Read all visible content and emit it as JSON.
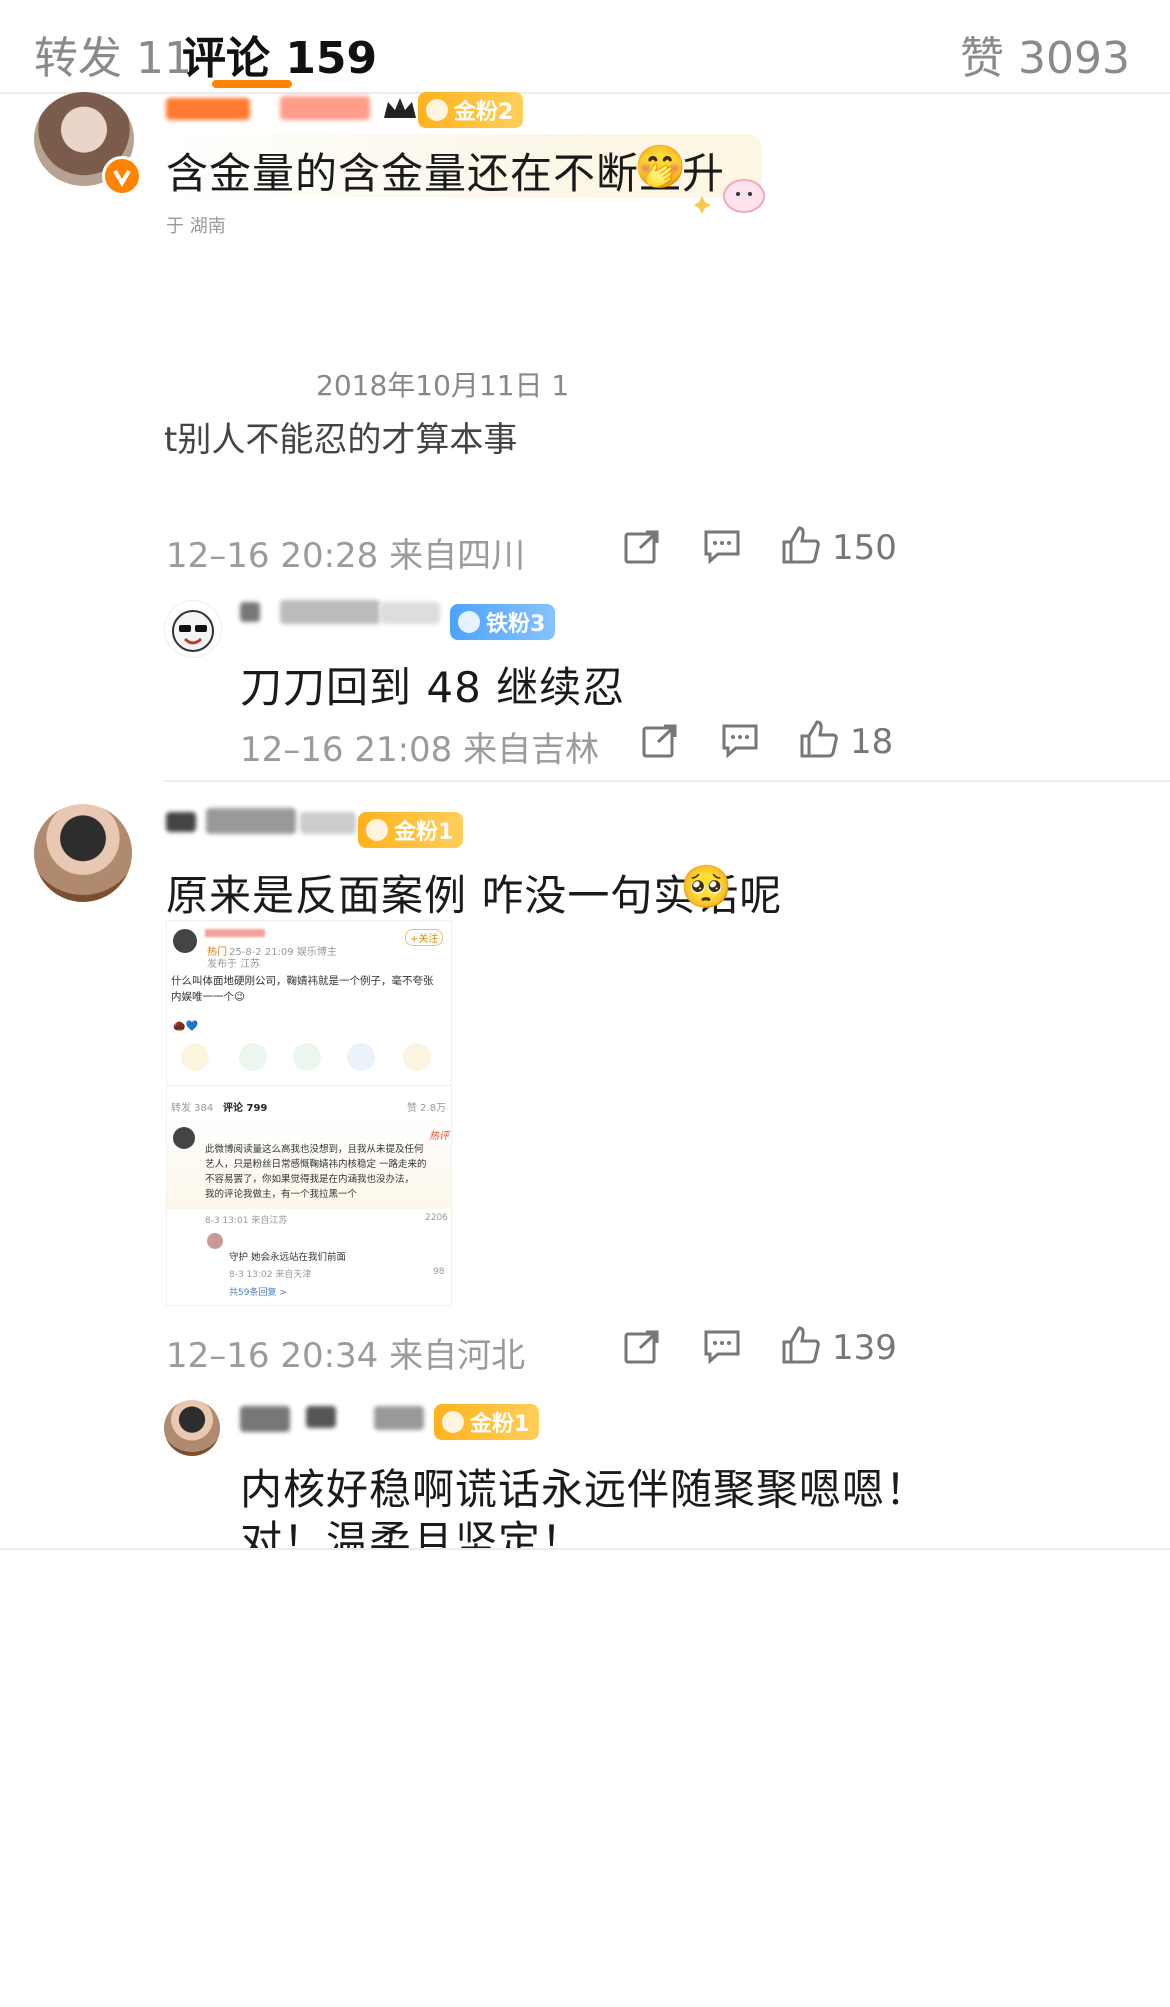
{
  "header": {
    "tab_repost": "转发 11",
    "tab_comments": "评论 159",
    "tab_likes": "赞 3093",
    "accent_color": "#ff8200"
  },
  "comments": [
    {
      "badge": "金粉2",
      "text": "含金量的含金量还在不断上升",
      "emoji": "🤭",
      "location_prefix": "于 湖南",
      "embedded_date": "2018年10月11日 1",
      "embedded_text": "t别人不能忍的才算本事",
      "meta": "12–16 20:28 来自四川",
      "likes": "150"
    },
    {
      "badge": "铁粉3",
      "text": "刀刀回到 48 继续忍",
      "meta": "12–16 21:08 来自吉林",
      "likes": "18"
    },
    {
      "badge": "金粉1",
      "text": "原来是反面案例 咋没一句实话呢",
      "emoji": "🥺",
      "meta": "12–16 20:34 来自河北",
      "likes": "139"
    },
    {
      "badge": "金粉1",
      "text_line1": "内核好稳啊谎话永远伴随聚聚嗯嗯！",
      "text_line2": "对！温柔且坚定！"
    }
  ],
  "embedded_post": {
    "follow": "+关注",
    "hot_tag": "热门",
    "post_meta": "25-8-2 21:09 娱乐博主",
    "post_from": "发布于 江苏",
    "post_text_1": "什么叫体面地硬刚公司，鞠婧祎就是一个例子，毫不夸张",
    "post_text_2": "内娱唯一一个😉",
    "repost": "转发 384",
    "comments": "评论 799",
    "likes": "赞 2.8万",
    "hot_label": "热评",
    "reply1_l1": "此微博阅读量这么高我也没想到，且我从未提及任何",
    "reply1_l2": "艺人，只是粉丝日常感慨鞠婧祎内核稳定 一路走来的",
    "reply1_l3": "不容易罢了，你如果觉得我是在内涵我也没办法，",
    "reply1_l4": "我的评论我做主，有一个我拉黑一个",
    "reply1_meta": "8-3 13:01 来自江苏",
    "reply1_likes": "2206",
    "reply2_text": "守护 她会永远站在我们前面",
    "reply2_meta": "8-3 13:02 来自天津",
    "reply2_likes": "98",
    "more_replies": "共59条回复 >"
  }
}
